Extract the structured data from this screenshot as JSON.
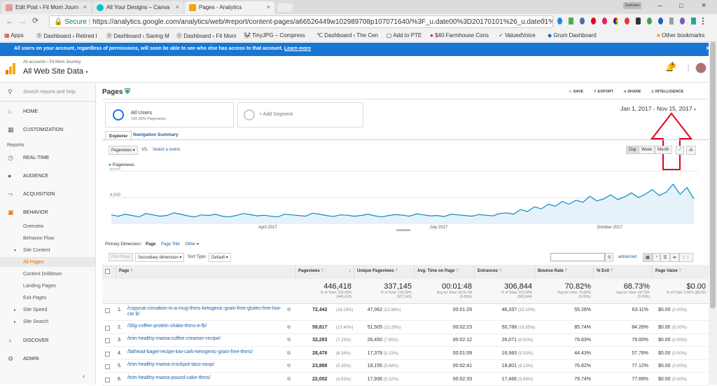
{
  "tabs": [
    {
      "title": "Edit Post ‹ Fit Mom Journ",
      "color": "#d9a0a0"
    },
    {
      "title": "All Your Designs – Canva",
      "color": "#00c4cc"
    },
    {
      "title": "Pages - Analytics",
      "color": "#f4a30e"
    }
  ],
  "omnibox": {
    "secure": "Secure",
    "url": "https://analytics.google.com/analytics/web/#report/content-pages/a66526449w102989708p107071640/%3F_u.date00%3D20170101%26_u.date01%3D..."
  },
  "bookmarks": [
    "Apps",
    "Dashboard ‹ Retired I",
    "Dashboard ‹ Saving M",
    "Dashboard ‹ Fit Mom",
    "TinyJPG – Compress",
    "Dashboard ‹ The Cen",
    "Add to PTE",
    "$40 Farmhouse Cons",
    "ValuedVoice",
    "Grum Dashboard",
    "Other bookmarks"
  ],
  "banner": {
    "text": "All users on your account, regardless of permissions, will soon be able to see who else has access to that account.",
    "link": "Learn more"
  },
  "header": {
    "breadcrumb": "All accounts › Fit Mom Journey",
    "property": "All Web Site Data",
    "notif_count": "1"
  },
  "sidebar": {
    "search": "Search reports and help",
    "home": "HOME",
    "custom": "CUSTOMIZATION",
    "reports": "Reports",
    "realtime": "REAL-TIME",
    "audience": "AUDIENCE",
    "acquisition": "ACQUISITION",
    "behavior": "BEHAVIOR",
    "behavior_items": [
      "Overview",
      "Behavior Flow"
    ],
    "site_content": "Site Content",
    "site_content_items": [
      "All Pages",
      "Content Drilldown",
      "Landing Pages",
      "Exit Pages"
    ],
    "site_speed": "Site Speed",
    "site_search": "Site Search",
    "discover": "DISCOVER",
    "admin": "ADMIN"
  },
  "report": {
    "title": "Pages",
    "actions": [
      "SAVE",
      "EXPORT",
      "SHARE",
      "INTELLIGENCE"
    ],
    "segment": {
      "name": "All Users",
      "sub": "100.00% Pageviews",
      "add": "+ Add Segment"
    },
    "date_range": "Jan 1, 2017 - Nov 15, 2017",
    "tabs": [
      "Explorer",
      "Navigation Summary"
    ],
    "metric": "Pageviews",
    "vs": "VS.",
    "select_metric": "Select a metric",
    "granularity": [
      "Day",
      "Week",
      "Month"
    ],
    "primary_dimension_label": "Primary Dimension:",
    "dimensions": [
      "Page",
      "Page Title",
      "Other"
    ],
    "plot_rows": "Plot Rows",
    "secondary_dimension": "Secondary dimension",
    "sort_type_label": "Sort Type:",
    "sort_type": "Default",
    "advanced": "advanced"
  },
  "chart_data": {
    "type": "line",
    "series": [
      {
        "name": "Pageviews",
        "values": [
          1400,
          1200,
          1500,
          1300,
          1100,
          1600,
          1400,
          1200,
          1300,
          1700,
          1500,
          1250,
          1100,
          1400,
          1300,
          1500,
          1200,
          1100,
          1300,
          1600,
          1450,
          1250,
          1350,
          1200,
          1100,
          1500,
          1400,
          1300,
          1200,
          1650,
          1500,
          1300,
          1150,
          1400,
          1350,
          1200,
          1300,
          1500,
          1250,
          1100,
          1300,
          1450,
          1350,
          1200,
          1550,
          1400,
          1250,
          1300,
          1150,
          1500,
          1400,
          1300,
          1200,
          1450,
          1350,
          1250,
          1600,
          1700,
          1500,
          2200,
          1900,
          2600,
          2300,
          3000,
          2700,
          3400,
          3000,
          3600,
          3300,
          4200,
          3500,
          3800,
          4400,
          3700,
          4100,
          4700,
          4000,
          4500,
          5200,
          4300,
          4800,
          6000,
          4500,
          5500,
          3800
        ]
      }
    ],
    "x_labels": [
      "April 2017",
      "July 2017",
      "October 2017"
    ],
    "y_ticks": [
      "8,000",
      "4,000"
    ],
    "ylim": [
      0,
      8000
    ],
    "grid": true,
    "color": "#058dc7"
  },
  "table": {
    "headers": [
      "Page",
      "Pageviews",
      "Unique Pageviews",
      "Avg. Time on Page",
      "Entrances",
      "Bounce Rate",
      "% Exit",
      "Page Value"
    ],
    "totals": [
      {
        "v": "446,418",
        "s": "% of Total: 100.00% (446,418)"
      },
      {
        "v": "337,145",
        "s": "% of Total: 100.00% (337,145)"
      },
      {
        "v": "00:01:48",
        "s": "Avg for View: 00:01:48 (0.00%)"
      },
      {
        "v": "306,844",
        "s": "% of Total: 100.00% (306,844)"
      },
      {
        "v": "70.82%",
        "s": "Avg for View: 70.82% (0.00%)"
      },
      {
        "v": "68.73%",
        "s": "Avg for View: 68.73% (0.00%)"
      },
      {
        "v": "$0.00",
        "s": "% of Total: 0.00% ($0.00)"
      }
    ],
    "rows": [
      {
        "n": "1.",
        "page": "/copycat-cinnabon-in-a-mug-thms-ketogenic-grain-free-gluten-free-low-car b/",
        "pv": "72,442",
        "pvp": "(16.23%)",
        "upv": "47,062",
        "upvp": "(13.96%)",
        "t": "00:01:29",
        "e": "46,337",
        "ep": "(15.10%)",
        "br": "55.26%",
        "ex": "63.11%",
        "val": "$0.00",
        "valp": "(0.00%)"
      },
      {
        "n": "2.",
        "page": "/30g-coffee-protein-shake-thms-e-fb/",
        "pv": "59,817",
        "pvp": "(13.40%)",
        "upv": "51,505",
        "upvp": "(15.28%)",
        "t": "00:02:23",
        "e": "50,788",
        "ep": "(16.55%)",
        "br": "85.74%",
        "ex": "84.28%",
        "val": "$0.00",
        "valp": "(0.00%)"
      },
      {
        "n": "3.",
        "page": "/trim-healthy-mama-coffee-creamer-recipe/",
        "pv": "32,283",
        "pvp": "(7.23%)",
        "upv": "26,450",
        "upvp": "(7.85%)",
        "t": "00:02:12",
        "e": "26,071",
        "ep": "(8.50%)",
        "br": "79.63%",
        "ex": "79.00%",
        "val": "$0.00",
        "valp": "(0.00%)"
      },
      {
        "n": "4.",
        "page": "/fathead-bagel-recipe-low-carb-ketogenic-grain-free-thms/",
        "pv": "28,476",
        "pvp": "(6.38%)",
        "upv": "17,378",
        "upvp": "(5.15%)",
        "t": "00:01:09",
        "e": "16,983",
        "ep": "(5.53%)",
        "br": "44.43%",
        "ex": "57.78%",
        "val": "$0.00",
        "valp": "(0.00%)"
      },
      {
        "n": "5.",
        "page": "/trim-healthy-mama-crockpot-taco-soup/",
        "pv": "23,888",
        "pvp": "(5.35%)",
        "upv": "19,155",
        "upvp": "(5.68%)",
        "t": "00:02:41",
        "e": "18,801",
        "ep": "(6.13%)",
        "br": "76.82%",
        "ex": "77.12%",
        "val": "$0.00",
        "valp": "(0.00%)"
      },
      {
        "n": "6.",
        "page": "/trim-healthy-mama-pound-cake-thms/",
        "pv": "22,002",
        "pvp": "(4.93%)",
        "upv": "17,936",
        "upvp": "(5.32%)",
        "t": "00:02:33",
        "e": "17,466",
        "ep": "(5.69%)",
        "br": "79.74%",
        "ex": "77.89%",
        "val": "$0.00",
        "valp": "(0.00%)"
      }
    ]
  }
}
